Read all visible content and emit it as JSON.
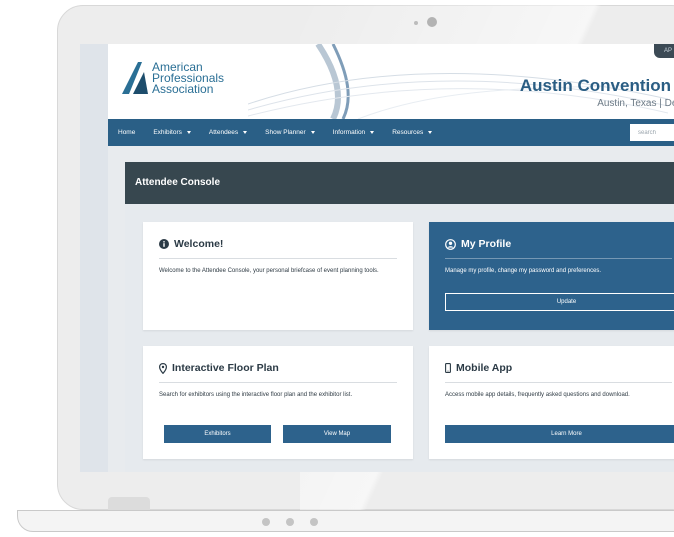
{
  "brand": {
    "logo_lines": [
      "American",
      "Professionals",
      "Association"
    ],
    "logo_color": "#2a6f95"
  },
  "venue": {
    "title": "Austin Convention C",
    "subtitle": "Austin, Texas  |  Dece"
  },
  "header_tab": "AP",
  "nav": {
    "items": [
      {
        "label": "Home",
        "dropdown": false
      },
      {
        "label": "Exhibitors",
        "dropdown": true
      },
      {
        "label": "Attendees",
        "dropdown": true
      },
      {
        "label": "Show Planner",
        "dropdown": true
      },
      {
        "label": "Information",
        "dropdown": true
      },
      {
        "label": "Resources",
        "dropdown": true
      }
    ],
    "search_placeholder": "search",
    "bg_color": "#2a5f86"
  },
  "console": {
    "title": "Attendee Console"
  },
  "cards": {
    "welcome": {
      "icon": "info-circle-icon",
      "title": "Welcome!",
      "text": "Welcome to the Attendee Console, your personal briefcase of event planning tools."
    },
    "profile": {
      "icon": "user-circle-icon",
      "title": "My Profile",
      "text": "Manage my profile, change my password and preferences.",
      "button": "Update"
    },
    "floorplan": {
      "icon": "map-marker-icon",
      "title": "Interactive Floor Plan",
      "text": "Search for exhibitors using the interactive floor plan and the exhibitor list.",
      "buttons": [
        "Exhibitors",
        "View Map"
      ]
    },
    "mobile": {
      "icon": "mobile-phone-icon",
      "title": "Mobile App",
      "text": "Access mobile app details, frequently asked questions and download.",
      "button": "Learn More"
    }
  },
  "colors": {
    "primary": "#2d628c",
    "console_bar": "#37474f",
    "heading": "#2a5d83"
  }
}
